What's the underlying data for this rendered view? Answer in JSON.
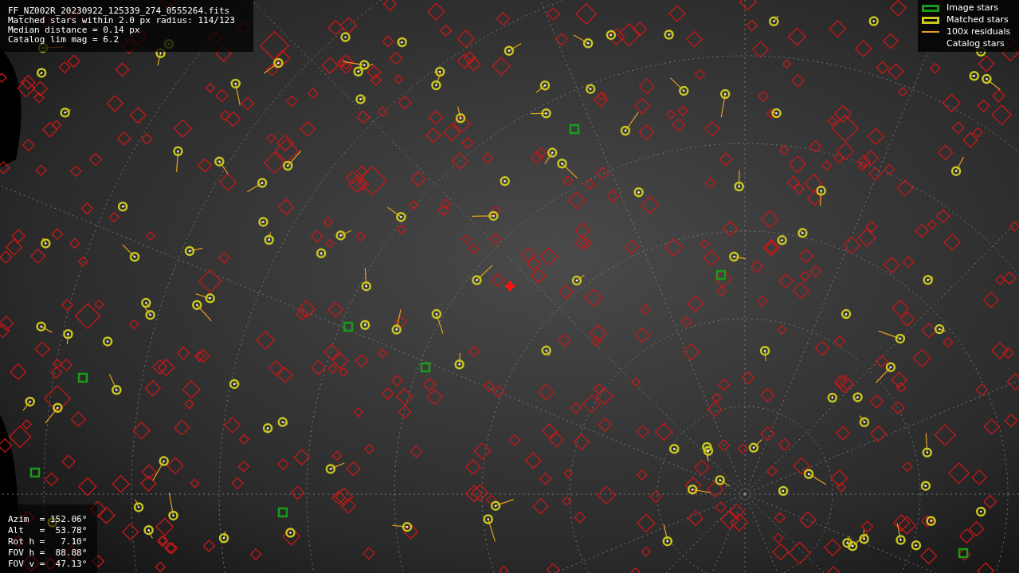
{
  "info": [
    "FF_NZ002R_20230922_125339_274_0555264.fits",
    "Matched stars within 2.0 px radius: 114/123",
    "Median distance = 0.14 px",
    "Catalog lim mag = 6.2"
  ],
  "legend": [
    {
      "kind": "image",
      "label": "Image stars"
    },
    {
      "kind": "matched",
      "label": "Matched stars"
    },
    {
      "kind": "residual",
      "label": "100x residuals"
    },
    {
      "kind": "catalog",
      "label": "Catalog stars"
    }
  ],
  "pointing": [
    "Azim  = 152.06°",
    "Alt   =  53.78°",
    "Rot h =   7.10°",
    "FOV h =  88.88°",
    "FOV v =  47.13°"
  ]
}
